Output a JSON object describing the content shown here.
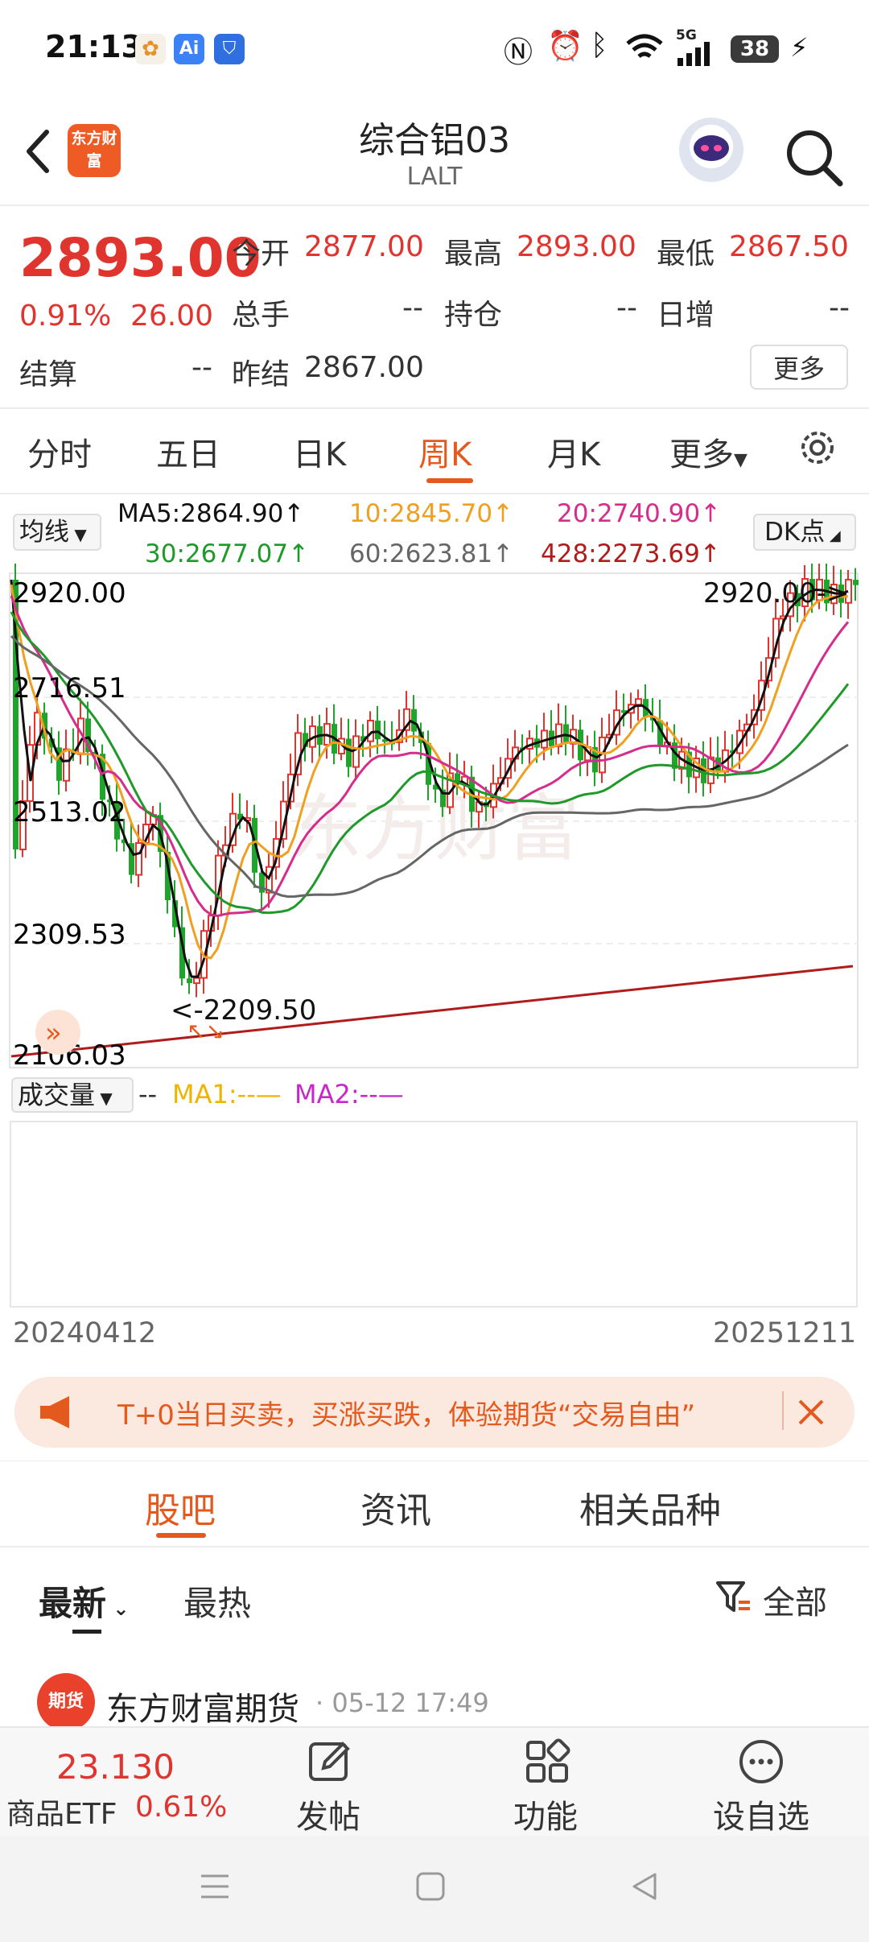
{
  "status_bar": {
    "time": "21:13",
    "network": "5G",
    "battery": "38",
    "icons": [
      "app-notification-icon",
      "ai-icon",
      "shield-icon",
      "nfc-icon",
      "alarm-icon",
      "bluetooth-icon",
      "wifi-icon",
      "signal-icon",
      "battery-icon",
      "charging-icon"
    ]
  },
  "header": {
    "logo_text": "东方财富",
    "title": "综合铝03",
    "subtitle": "LALT"
  },
  "quote": {
    "price": "2893.00",
    "change_pct": "0.91%",
    "change_abs": "26.00",
    "open_label": "今开",
    "open": "2877.00",
    "high_label": "最高",
    "high": "2893.00",
    "low_label": "最低",
    "low": "2867.50",
    "volume_label": "总手",
    "volume": "--",
    "oi_label": "持仓",
    "oi": "--",
    "daily_inc_label": "日增",
    "daily_inc": "--",
    "settle_label": "结算",
    "settle": "--",
    "prev_settle_label": "昨结",
    "prev_settle": "2867.00",
    "more": "更多"
  },
  "period_tabs": [
    "分时",
    "五日",
    "日K",
    "周K",
    "月K",
    "更多"
  ],
  "ma": {
    "select": "均线",
    "ma5": "MA5:2864.90↑",
    "ma10": "10:2845.70↑",
    "ma20": "20:2740.90↑",
    "ma30": "30:2677.07↑",
    "ma60": "60:2623.81↑",
    "ma428": "428:2273.69↑",
    "dk": "DK点",
    "colors": {
      "ma5": "#111111",
      "ma10": "#f0a020",
      "ma20": "#d62c8c",
      "ma30": "#1f9a2a",
      "ma60": "#666666",
      "ma428": "#b01c1c"
    }
  },
  "chart": {
    "y_labels": [
      "2920.00",
      "2716.51",
      "2513.02",
      "2309.53",
      "2106.03"
    ],
    "max_marker": "2920.00->",
    "min_marker": "<-2209.50",
    "watermark": "东方财富",
    "up_color": "#e0342f",
    "down_color": "#1fa52c"
  },
  "volume": {
    "select": "成交量",
    "dash": "--",
    "ma1": "MA1:--",
    "ma2": "MA2:--",
    "ma1_color": "#f0b400",
    "ma2_color": "#c828c8"
  },
  "dates": {
    "start": "20240412",
    "end": "20251211"
  },
  "banner": {
    "text": "T+0当日买卖，买涨买跌，体验期货“交易自由”"
  },
  "content_tabs": [
    "股吧",
    "资讯",
    "相关品种"
  ],
  "feed": {
    "sort_newest": "最新",
    "sort_hot": "最热",
    "filter": "全部",
    "post_author": "东方财富期货",
    "post_time": "· 05-12 17:49",
    "avatar_text": "期货"
  },
  "bottom_bar": {
    "etf_price": "23.130",
    "etf_name": "商品ETF",
    "etf_pct": "0.61%",
    "post": "发帖",
    "function": "功能",
    "watchlist": "设自选"
  }
}
